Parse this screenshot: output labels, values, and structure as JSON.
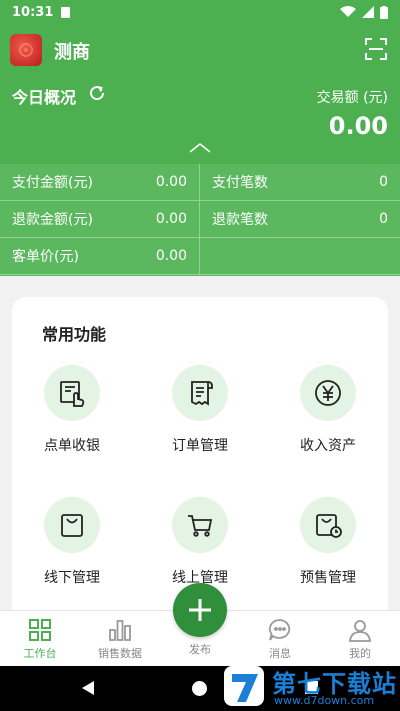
{
  "status_bar": {
    "time": "10:31"
  },
  "header": {
    "app_name": "测商",
    "today_title": "今日概况",
    "trade_label": "交易额 (元)",
    "trade_value": "0.00"
  },
  "stats": [
    {
      "label": "支付金额(元)",
      "value": "0.00"
    },
    {
      "label": "支付笔数",
      "value": "0"
    },
    {
      "label": "退款金额(元)",
      "value": "0.00"
    },
    {
      "label": "退款笔数",
      "value": "0"
    },
    {
      "label": "客单价(元)",
      "value": "0.00"
    }
  ],
  "functions": {
    "title": "常用功能",
    "items": [
      {
        "label": "点单收银",
        "icon": "cashier-icon"
      },
      {
        "label": "订单管理",
        "icon": "receipt-icon"
      },
      {
        "label": "收入资产",
        "icon": "yen-icon"
      },
      {
        "label": "线下管理",
        "icon": "shopping-bag-icon"
      },
      {
        "label": "线上管理",
        "icon": "cart-icon"
      },
      {
        "label": "预售管理",
        "icon": "presale-bag-icon"
      }
    ]
  },
  "bottom_nav": [
    {
      "label": "工作台",
      "icon": "grid-icon",
      "active": true
    },
    {
      "label": "销售数据",
      "icon": "bar-chart-icon",
      "active": false
    },
    {
      "label": "发布",
      "icon": "plus-icon",
      "active": false
    },
    {
      "label": "消息",
      "icon": "chat-icon",
      "active": false
    },
    {
      "label": "我的",
      "icon": "user-icon",
      "active": false
    }
  ],
  "watermark": {
    "title": "第七下载站",
    "url": "www.d7down.com"
  },
  "colors": {
    "primary": "#4caf50",
    "primary_dark": "#2f8f3a",
    "icon_bg": "#e3f4e4"
  }
}
